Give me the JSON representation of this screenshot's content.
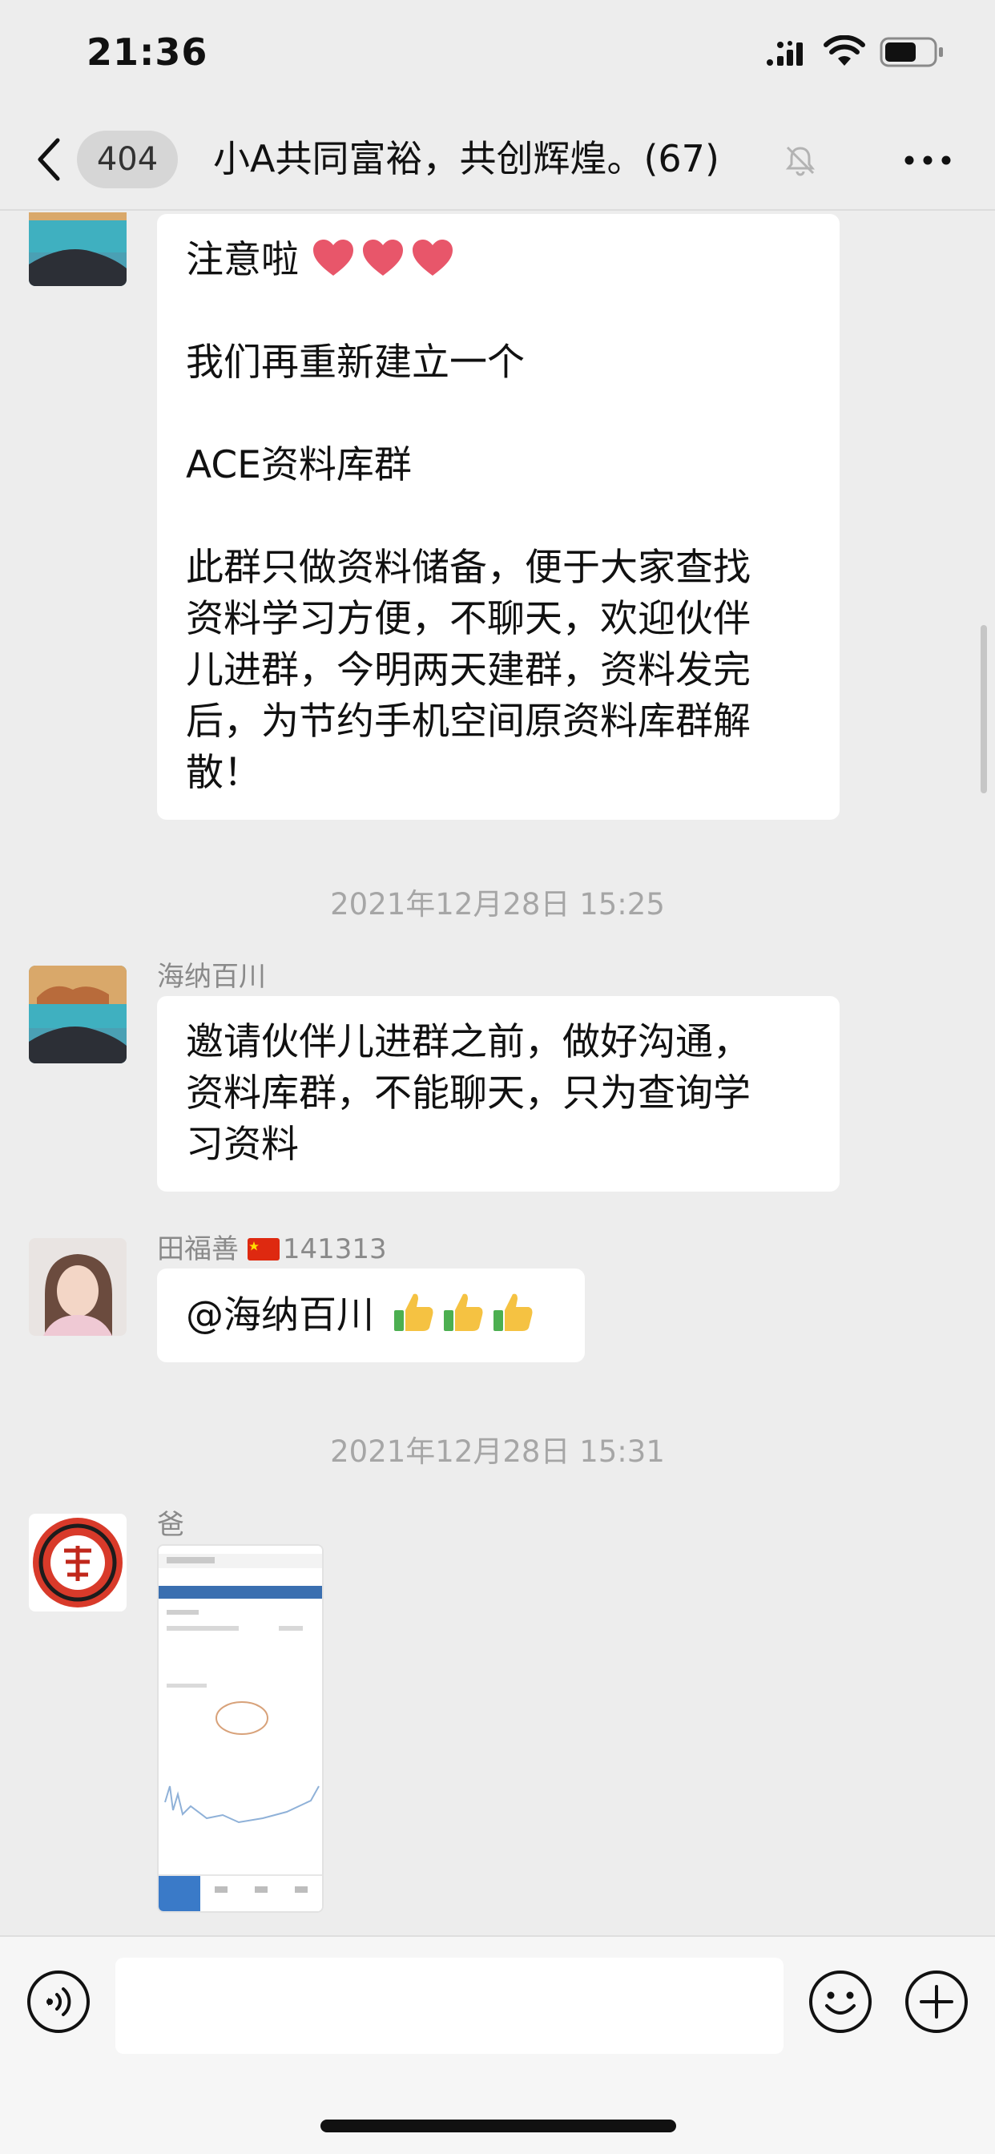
{
  "status_bar": {
    "time": "21:36",
    "icons": [
      "signal-icon",
      "wifi-icon",
      "battery-icon"
    ]
  },
  "nav": {
    "unread_count": "404",
    "title": "小A共同富裕，共创辉煌。(67)",
    "icons": [
      "chevron-left-icon",
      "mute-bell-icon",
      "more-dots-icon"
    ]
  },
  "messages": [
    {
      "sender": "",
      "lines": [
        "注意啦",
        "",
        "我们再重新建立一个",
        "",
        "ACE资料库群",
        "",
        "此群只做资料储备，便于大家查找",
        "资料学习方便，不聊天，欢迎伙伴",
        "儿进群，今明两天建群，资料发完",
        "后，为节约手机空间原资料库群解",
        "散！"
      ],
      "emoji": [
        "heart-emoji",
        "heart-emoji",
        "heart-emoji"
      ]
    },
    {
      "sender": "海纳百川",
      "lines": [
        "邀请伙伴儿进群之前，做好沟通，",
        "资料库群，不能聊天，只为查询学",
        "习资料"
      ]
    },
    {
      "sender": "田福善",
      "sender_suffix": "141313",
      "text": "@海纳百川",
      "emoji": [
        "thumbs-up-emoji",
        "thumbs-up-emoji",
        "thumbs-up-emoji"
      ]
    },
    {
      "sender": "爸",
      "image": "phone-screenshot-thumbnail"
    }
  ],
  "timestamps": [
    "2021年12月28日 15:25",
    "2021年12月28日 15:31"
  ],
  "input_bar": {
    "text_value": "",
    "icons": [
      "voice-icon",
      "emoji-icon",
      "plus-icon"
    ]
  },
  "colors": {
    "background": "#ededed",
    "bubble": "#ffffff",
    "timestamp": "#a6a6a6",
    "sender_name": "#8a8a8a"
  }
}
